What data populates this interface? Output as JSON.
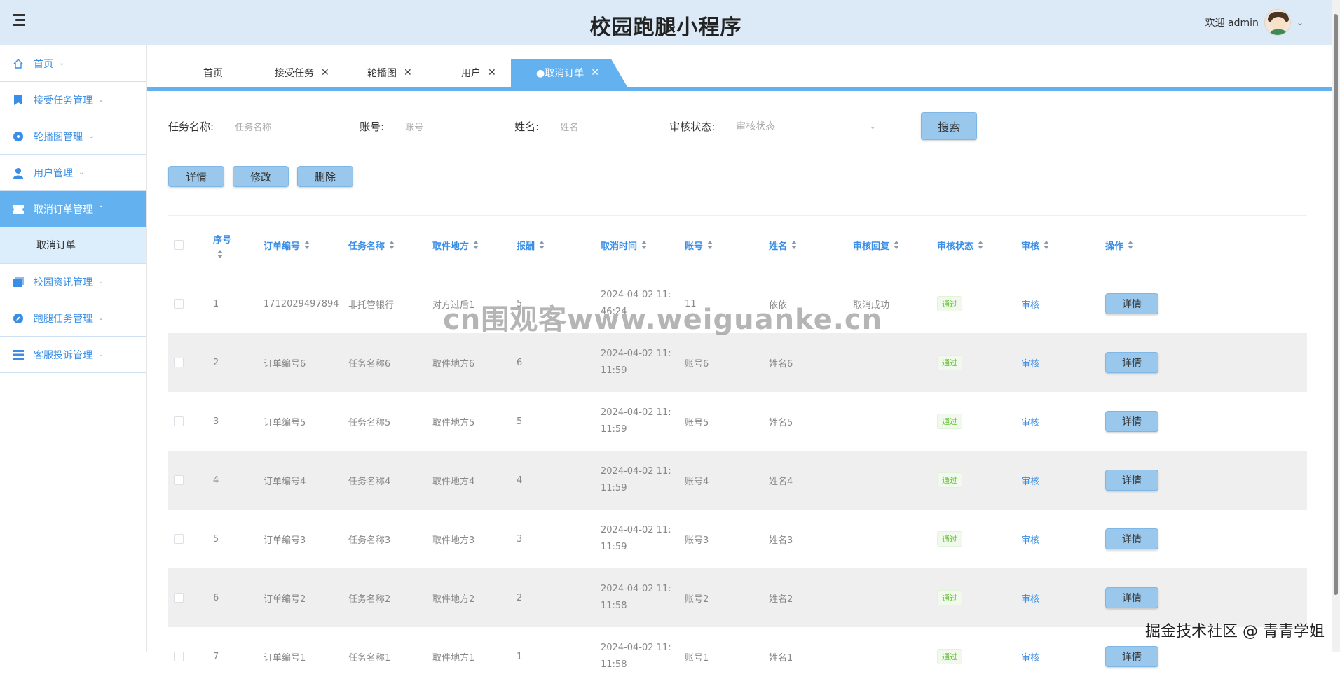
{
  "header": {
    "title": "校园跑腿小程序",
    "welcome": "欢迎 admin"
  },
  "sidebar": {
    "items": [
      {
        "label": "首页",
        "icon": "home-icon"
      },
      {
        "label": "接受任务管理",
        "icon": "bookmark-icon"
      },
      {
        "label": "轮播图管理",
        "icon": "disc-icon"
      },
      {
        "label": "用户管理",
        "icon": "user-icon"
      },
      {
        "label": "取消订单管理",
        "icon": "ticket-icon",
        "active": true
      },
      {
        "label": "校园资讯管理",
        "icon": "folder-icon"
      },
      {
        "label": "跑腿任务管理",
        "icon": "compass-icon"
      },
      {
        "label": "客服投诉管理",
        "icon": "list-icon"
      }
    ],
    "sub_item": "取消订单"
  },
  "tabs": [
    "首页",
    "接受任务",
    "轮播图",
    "用户",
    "●取消订单"
  ],
  "search": {
    "task_label": "任务名称:",
    "task_placeholder": "任务名称",
    "account_label": "账号:",
    "account_placeholder": "账号",
    "name_label": "姓名:",
    "name_placeholder": "姓名",
    "status_label": "审核状态:",
    "status_placeholder": "审核状态",
    "search_button": "搜索"
  },
  "actions": {
    "detail": "详情",
    "edit": "修改",
    "delete": "删除"
  },
  "table": {
    "headers": [
      "序号",
      "订单编号",
      "任务名称",
      "取件地方",
      "报酬",
      "取消时间",
      "账号",
      "姓名",
      "审核回复",
      "审核状态",
      "审核",
      "操作"
    ],
    "rows": [
      {
        "no": "1",
        "order": "1712029497894",
        "task": "非托管银行",
        "place": "对方过后1",
        "pay": "5",
        "time": "2024-04-02 11:\n46:24",
        "account": "11",
        "name": "依依",
        "reply": "取消成功",
        "status": "通过",
        "audit": "审核",
        "op": "详情"
      },
      {
        "no": "2",
        "order": "订单编号6",
        "task": "任务名称6",
        "place": "取件地方6",
        "pay": "6",
        "time": "2024-04-02 11:\n11:59",
        "account": "账号6",
        "name": "姓名6",
        "reply": "",
        "status": "通过",
        "audit": "审核",
        "op": "详情"
      },
      {
        "no": "3",
        "order": "订单编号5",
        "task": "任务名称5",
        "place": "取件地方5",
        "pay": "5",
        "time": "2024-04-02 11:\n11:59",
        "account": "账号5",
        "name": "姓名5",
        "reply": "",
        "status": "通过",
        "audit": "审核",
        "op": "详情"
      },
      {
        "no": "4",
        "order": "订单编号4",
        "task": "任务名称4",
        "place": "取件地方4",
        "pay": "4",
        "time": "2024-04-02 11:\n11:59",
        "account": "账号4",
        "name": "姓名4",
        "reply": "",
        "status": "通过",
        "audit": "审核",
        "op": "详情"
      },
      {
        "no": "5",
        "order": "订单编号3",
        "task": "任务名称3",
        "place": "取件地方3",
        "pay": "3",
        "time": "2024-04-02 11:\n11:59",
        "account": "账号3",
        "name": "姓名3",
        "reply": "",
        "status": "通过",
        "audit": "审核",
        "op": "详情"
      },
      {
        "no": "6",
        "order": "订单编号2",
        "task": "任务名称2",
        "place": "取件地方2",
        "pay": "2",
        "time": "2024-04-02 11:\n11:58",
        "account": "账号2",
        "name": "姓名2",
        "reply": "",
        "status": "通过",
        "audit": "审核",
        "op": "详情"
      },
      {
        "no": "7",
        "order": "订单编号1",
        "task": "任务名称1",
        "place": "取件地方1",
        "pay": "1",
        "time": "2024-04-02 11:\n11:58",
        "account": "账号1",
        "name": "姓名1",
        "reply": "",
        "status": "通过",
        "audit": "审核",
        "op": "详情"
      }
    ]
  },
  "watermark": "cn围观客www.weiguanke.cn",
  "footer_mark": "掘金技术社区 @ 青青学姐"
}
